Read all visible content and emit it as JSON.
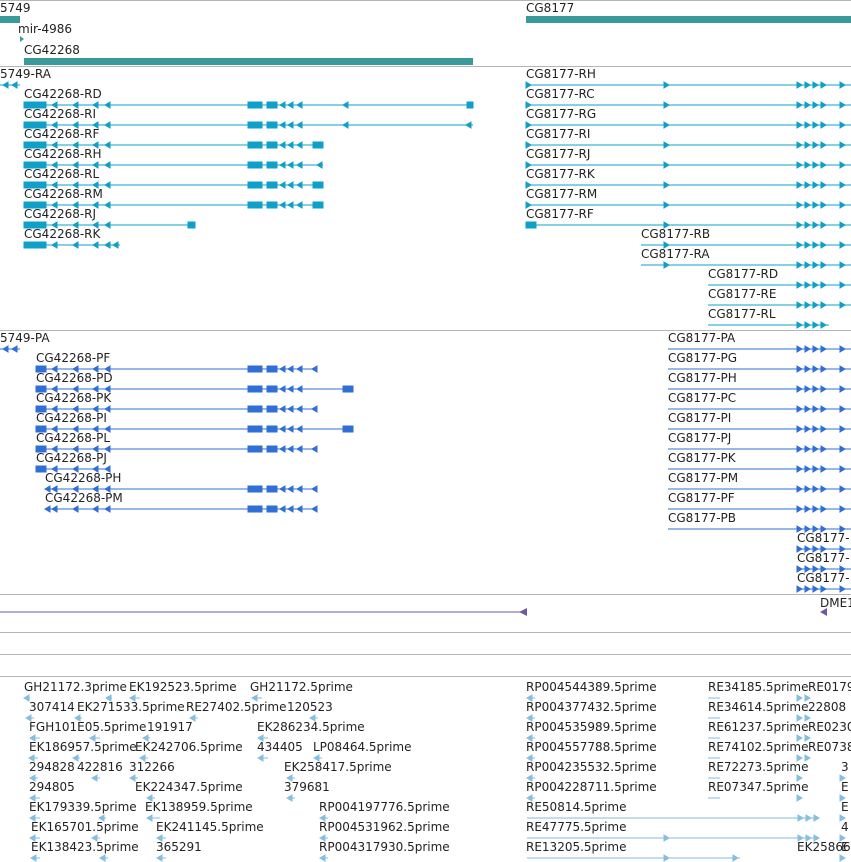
{
  "colors": {
    "gene": "#3a9a9a",
    "mrna": "#0ea0c8",
    "protein": "#2f6fd6",
    "est": "#86bede",
    "purple": "#6f57a8",
    "separator": "#b5b5b5"
  },
  "gene_track": {
    "labels": [
      "5749",
      "mir-4986",
      "CG42268",
      "CG8177"
    ]
  },
  "mrna_track": {
    "labels": [
      "5749-RA",
      "CG42268-RD",
      "CG42268-RI",
      "CG42268-RF",
      "CG42268-RH",
      "CG42268-RL",
      "CG42268-RM",
      "CG42268-RJ",
      "CG42268-RK",
      "CG8177-RH",
      "CG8177-RC",
      "CG8177-RG",
      "CG8177-RI",
      "CG8177-RJ",
      "CG8177-RK",
      "CG8177-RM",
      "CG8177-RF",
      "CG8177-RB",
      "CG8177-RA",
      "CG8177-RD",
      "CG8177-RE",
      "CG8177-RL"
    ]
  },
  "protein_track": {
    "labels": [
      "5749-PA",
      "CG42268-PF",
      "CG42268-PD",
      "CG42268-PK",
      "CG42268-PI",
      "CG42268-PL",
      "CG42268-PJ",
      "CG42268-PH",
      "CG42268-PM",
      "CG8177-PA",
      "CG8177-PG",
      "CG8177-PH",
      "CG8177-PC",
      "CG8177-PI",
      "CG8177-PJ",
      "CG8177-PK",
      "CG8177-PM",
      "CG8177-PF",
      "CG8177-PB",
      "CG8177-",
      "CG8177-",
      "CG8177-"
    ]
  },
  "misc_track": {
    "labels": [
      "DME1"
    ]
  },
  "est_track": {
    "labels": [
      "GH21172.3prime",
      "EK192523.5prime",
      "GH21172.5prime",
      "307414",
      "EK271533.5prime",
      "RE27402.5prime",
      "120523",
      "FGH101E05.5prime",
      "191917",
      "EK286234.5prime",
      "EK186957.5prime",
      "EK242706.5prime",
      "434405",
      "LP08464.5prime",
      "294828",
      "422816",
      "312266",
      "EK258417.5prime",
      "294805",
      "EK224347.5prime",
      "379681",
      "EK179339.5prime",
      "EK138959.5prime",
      "RP004197776.5prime",
      "EK165701.5prime",
      "EK241145.5prime",
      "RP004531962.5prime",
      "EK138423.5prime",
      "365291",
      "RP004317930.5prime",
      "RP004544389.5prime",
      "RP004377432.5prime",
      "RP004535989.5prime",
      "RP004557788.5prime",
      "RP004235532.5prime",
      "RP004228711.5prime",
      "RE50814.5prime",
      "RE47775.5prime",
      "RE13205.5prime",
      "RE34185.5prime",
      "RE0179",
      "RE34614.5prime",
      "22808",
      "RE61237.5prime",
      "RE0230",
      "RE74102.5prime",
      "RE0738",
      "RE72273.5prime",
      "3",
      "RE07347.5prime",
      "E",
      "E",
      "4",
      "E",
      "EK25866"
    ]
  }
}
